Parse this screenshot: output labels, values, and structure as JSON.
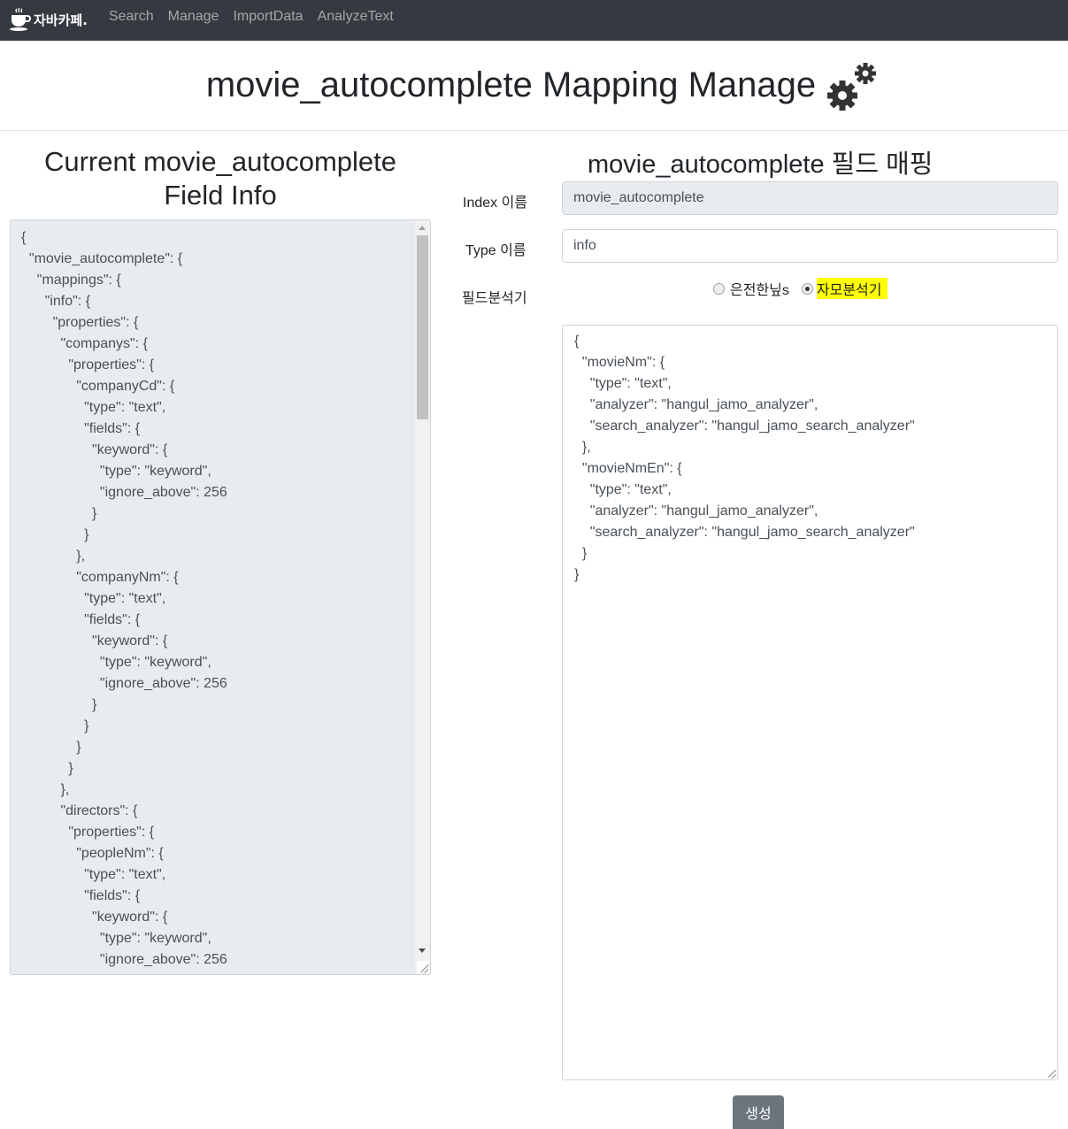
{
  "navbar": {
    "brand_icon": "coffee-cup-icon",
    "brand": "자바카페.",
    "links": [
      "Search",
      "Manage",
      "ImportData",
      "AnalyzeText"
    ]
  },
  "header": {
    "title": "movie_autocomplete Mapping Manage",
    "icon": "gears-icon"
  },
  "left": {
    "title_line1": "Current movie_autocomplete",
    "title_line2": "Field Info",
    "mapping_text": "{\n  \"movie_autocomplete\": {\n    \"mappings\": {\n      \"info\": {\n        \"properties\": {\n          \"companys\": {\n            \"properties\": {\n              \"companyCd\": {\n                \"type\": \"text\",\n                \"fields\": {\n                  \"keyword\": {\n                    \"type\": \"keyword\",\n                    \"ignore_above\": 256\n                  }\n                }\n              },\n              \"companyNm\": {\n                \"type\": \"text\",\n                \"fields\": {\n                  \"keyword\": {\n                    \"type\": \"keyword\",\n                    \"ignore_above\": 256\n                  }\n                }\n              }\n            }\n          },\n          \"directors\": {\n            \"properties\": {\n              \"peopleNm\": {\n                \"type\": \"text\",\n                \"fields\": {\n                  \"keyword\": {\n                    \"type\": \"keyword\",\n                    \"ignore_above\": 256\n                  }\n                }"
  },
  "right": {
    "title": "movie_autocomplete 필드 매핑",
    "index_label": "Index 이름",
    "index_value": "movie_autocomplete",
    "type_label": "Type 이름",
    "type_value": "info",
    "analyzer_label": "필드분석기",
    "analyzer_options": [
      {
        "label": "은전한닢s",
        "checked": false
      },
      {
        "label": "자모분석기",
        "checked": true
      }
    ],
    "highlight_color": "#ffff00",
    "mapping_text": "{\n  \"movieNm\": {\n    \"type\": \"text\",\n    \"analyzer\": \"hangul_jamo_analyzer\",\n    \"search_analyzer\": \"hangul_jamo_search_analyzer\"\n  },\n  \"movieNmEn\": {\n    \"type\": \"text\",\n    \"analyzer\": \"hangul_jamo_analyzer\",\n    \"search_analyzer\": \"hangul_jamo_search_analyzer\"\n  }\n}",
    "submit_label": "생성"
  }
}
